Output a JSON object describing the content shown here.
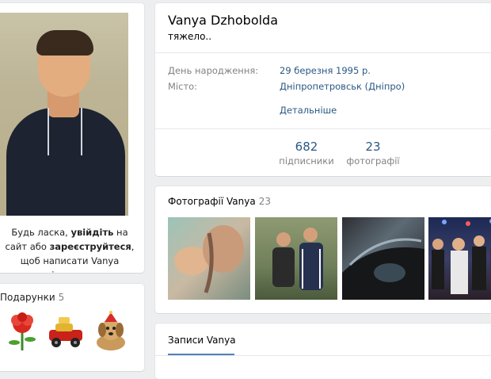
{
  "profile": {
    "name": "Vanya Dzhobolda",
    "status": "тяжело..",
    "birthday_label": "День народження:",
    "birthday_value": "29 березня 1995 р.",
    "city_label": "Місто:",
    "city_value": "Дніпропетровськ (Дніпро)",
    "details_link": "Детальніше"
  },
  "counters": {
    "followers_num": "682",
    "followers_label": "підписники",
    "photos_num": "23",
    "photos_label": "фотографії"
  },
  "login_message": {
    "part1": "Будь ласка, ",
    "login": "увійдіть",
    "part2": " на сайт або ",
    "register": "зареєструйтеся",
    "part3": ", щоб написати Vanya повідомлення."
  },
  "gifts": {
    "title": "Подарунки",
    "count": "5"
  },
  "photos": {
    "title": "Фотографії Vanya",
    "count": "23"
  },
  "posts": {
    "tab": "Записи Vanya"
  },
  "colors": {
    "link": "#2a5885",
    "muted": "#828282",
    "background": "#edeef0",
    "accent": "#5181b8"
  }
}
